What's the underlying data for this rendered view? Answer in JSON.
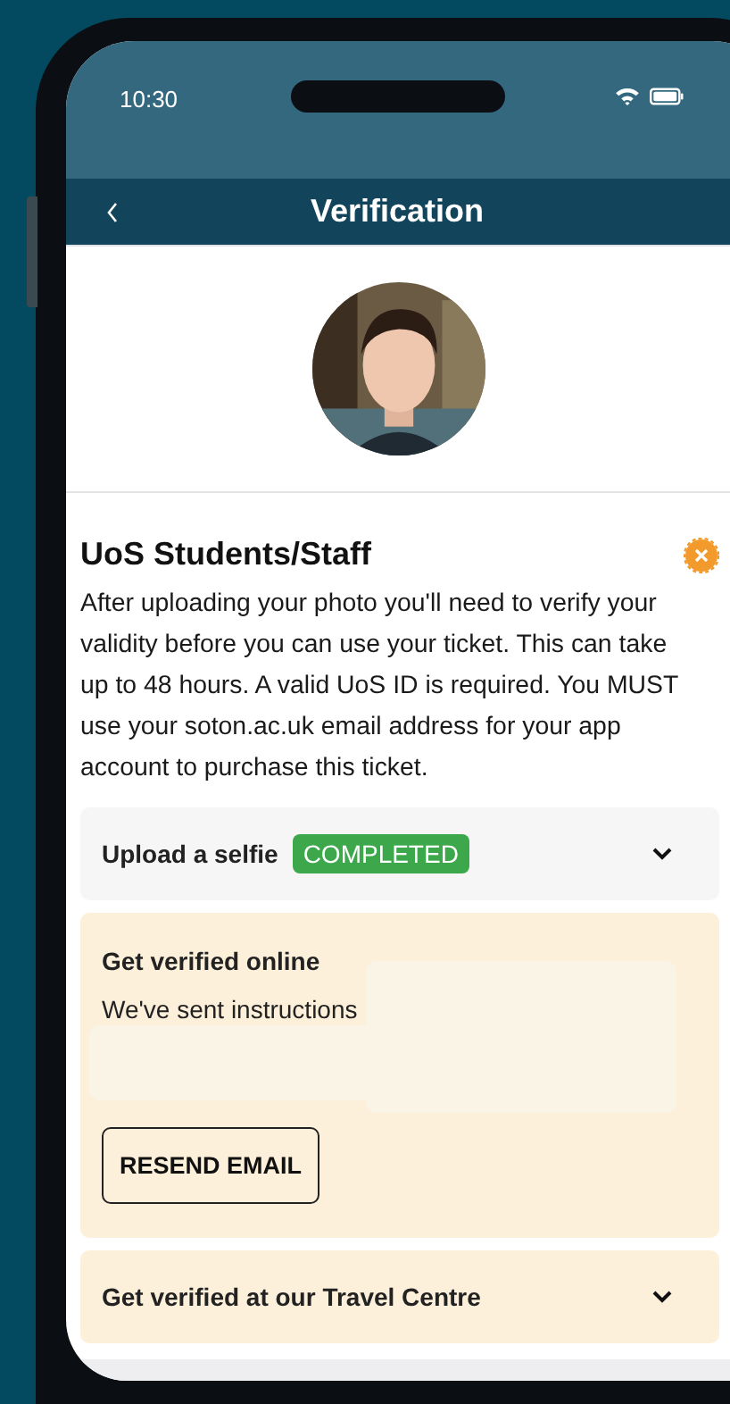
{
  "status_bar": {
    "time": "10:30"
  },
  "nav": {
    "title": "Verification"
  },
  "ticket": {
    "title": "UoS Students/Staff",
    "description": "After uploading your photo you'll need to verify your validity before you can use your ticket. This can take up to 48 hours. A valid UoS ID is required. You MUST use your soton.ac.uk email address for your app account to purchase this ticket."
  },
  "steps": [
    {
      "kind": "accordion",
      "title": "Upload a selfie",
      "badge": "COMPLETED",
      "completed": true,
      "expanded": false
    },
    {
      "kind": "panel",
      "title": "Get verified online",
      "text": "We've sent instructions",
      "button": "RESEND EMAIL",
      "completed": false
    },
    {
      "kind": "accordion",
      "title": "Get verified at our Travel Centre",
      "completed": false,
      "expanded": false
    }
  ]
}
